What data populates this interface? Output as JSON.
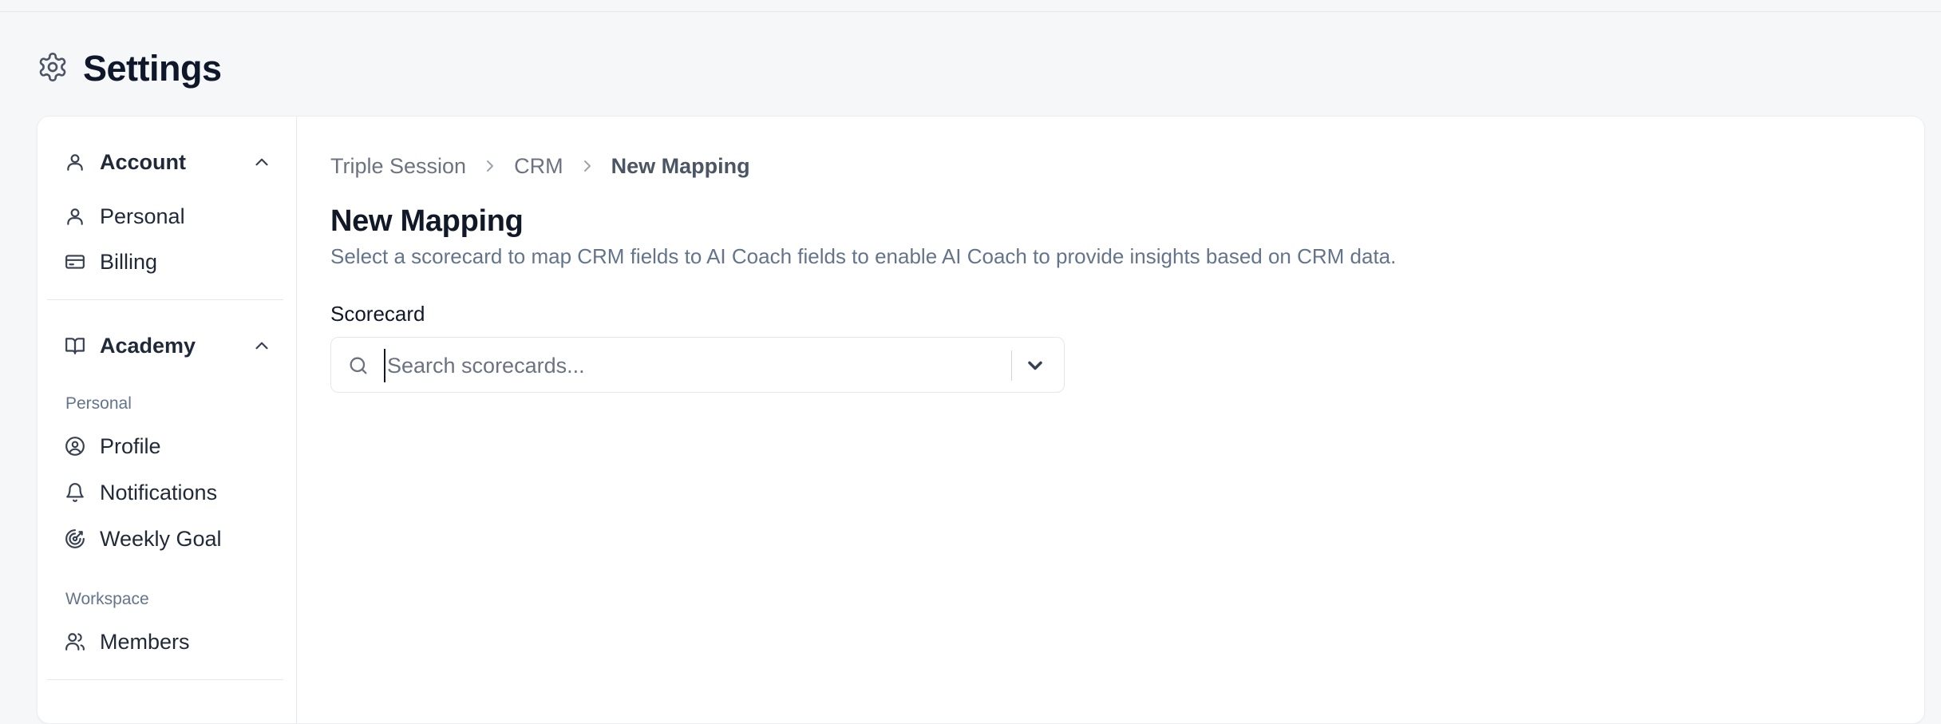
{
  "page": {
    "title": "Settings",
    "icon": "gear-icon"
  },
  "sidebar": {
    "account": {
      "title": "Account",
      "icon": "user-icon",
      "items": [
        {
          "label": "Personal",
          "icon": "user-icon"
        },
        {
          "label": "Billing",
          "icon": "credit-card-icon"
        }
      ]
    },
    "academy": {
      "title": "Academy",
      "icon": "book-open-icon",
      "groups": [
        {
          "label": "Personal",
          "items": [
            {
              "label": "Profile",
              "icon": "user-circle-icon"
            },
            {
              "label": "Notifications",
              "icon": "bell-icon"
            },
            {
              "label": "Weekly Goal",
              "icon": "target-icon"
            }
          ]
        },
        {
          "label": "Workspace",
          "items": [
            {
              "label": "Members",
              "icon": "users-icon"
            }
          ]
        }
      ]
    }
  },
  "main": {
    "breadcrumb": [
      "Triple Session",
      "CRM",
      "New Mapping"
    ],
    "heading": "New Mapping",
    "description": "Select a scorecard to map CRM fields to AI Coach fields to enable AI Coach to provide insights based on CRM data.",
    "scorecard": {
      "label": "Scorecard",
      "placeholder": "Search scorecards...",
      "value": ""
    }
  },
  "colors": {
    "text": "#111827",
    "muted": "#64748b",
    "border": "#e5e7eb",
    "background": "#f6f7f9"
  }
}
